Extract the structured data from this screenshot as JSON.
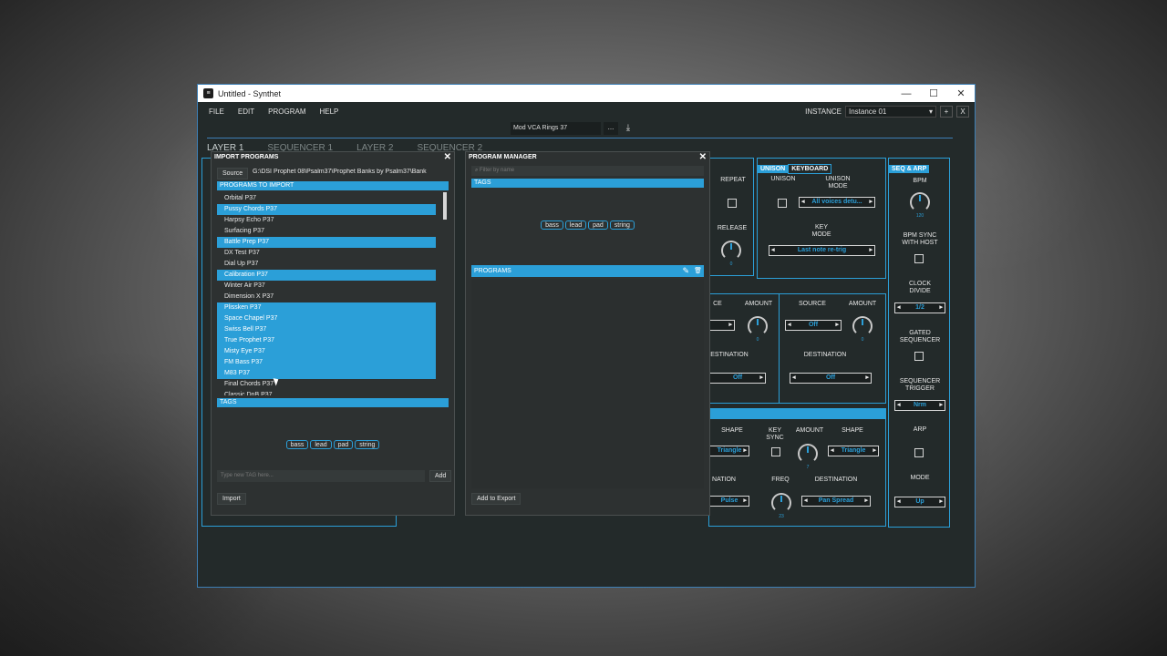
{
  "window": {
    "title": "Untitled - Synthet",
    "app_icon": "synthet-logo",
    "minimize": "—",
    "maximize": "☐",
    "close": "✕"
  },
  "menu": {
    "file": "FILE",
    "edit": "EDIT",
    "program": "PROGRAM",
    "help": "HELP",
    "instance_label": "INSTANCE",
    "instance_value": "Instance 01",
    "add": "+",
    "remove": "X"
  },
  "program_bar": {
    "name": "Mod VCA Rings 37",
    "browse": "...",
    "save_icon": "⤓"
  },
  "layer_tabs": [
    "LAYER 1",
    "SEQUENCER 1",
    "LAYER 2",
    "SEQUENCER 2"
  ],
  "synth": {
    "repeat": "REPEAT",
    "release": "RELEASE",
    "release_val": "0",
    "unison_tab": "UNISON",
    "keyboard_tab": "KEYBOARD",
    "unison": "UNISON",
    "unison_mode": "UNISON\nMODE",
    "unison_mode_val": "All voices detu...",
    "key_mode": "KEY\nMODE",
    "key_mode_val": "Last note re-trig",
    "source": "SOURCE",
    "amount": "AMOUNT",
    "amount_val": "0",
    "destination": "DESTINATION",
    "src_val": "Off",
    "dest_val": "Off",
    "shape": "SHAPE",
    "key_sync": "KEY\nSYNC",
    "lfo_amount_val": "7",
    "shape_val": "Triangle",
    "freq": "FREQ",
    "freq_val": "23",
    "lfo_dest_val": "Pan Spread",
    "pulse_val": "Pulse",
    "nation": "NATION",
    "ce": "CE",
    "estination": "ESTINATION"
  },
  "seq_arp": {
    "header": "SEQ & ARP",
    "bpm": "BPM",
    "bpm_val": "120",
    "bpm_sync": "BPM SYNC\nWITH HOST",
    "clock_divide": "CLOCK\nDIVIDE",
    "clock_val": "1/2",
    "gated": "GATED\nSEQUENCER",
    "trigger": "SEQUENCER\nTRIGGER",
    "trigger_val": "Nrm",
    "arp": "ARP",
    "mode": "MODE",
    "mode_val": "Up"
  },
  "import_dialog": {
    "title": "IMPORT PROGRAMS",
    "close": "✕",
    "source_btn": "Source",
    "source_path": "G:\\DSI Prophet 08\\Psalm37\\Prophet Banks by Psalm37\\Bank",
    "programs_header": "PROGRAMS TO IMPORT",
    "programs": [
      {
        "name": "Orbital P37",
        "selected": false
      },
      {
        "name": "Pussy Chords P37",
        "selected": true
      },
      {
        "name": "Harpsy Echo P37",
        "selected": false
      },
      {
        "name": "Surfacing  P37",
        "selected": false
      },
      {
        "name": "Battle Prep P37",
        "selected": true
      },
      {
        "name": "DX Test  P37",
        "selected": false
      },
      {
        "name": "Dial Up P37",
        "selected": false
      },
      {
        "name": "Calibration P37",
        "selected": true
      },
      {
        "name": "Winter Air P37",
        "selected": false
      },
      {
        "name": "Dimension X P37",
        "selected": false
      },
      {
        "name": "Plissken P37",
        "selected": true
      },
      {
        "name": "Space Chapel P37",
        "selected": true
      },
      {
        "name": "Swiss Bell P37",
        "selected": true
      },
      {
        "name": "True Prophet P37",
        "selected": true
      },
      {
        "name": "Misty Eye  P37",
        "selected": true
      },
      {
        "name": "FM Bass P37",
        "selected": true
      },
      {
        "name": "M83  P37",
        "selected": true
      },
      {
        "name": "Final Chords P37",
        "selected": false
      },
      {
        "name": "Classic DnB P37",
        "selected": false
      }
    ],
    "tags_header": "TAGS",
    "tags": [
      "bass",
      "lead",
      "pad",
      "string"
    ],
    "tag_placeholder": "Type new TAG here...",
    "add_btn": "Add",
    "import_btn": "Import"
  },
  "manager_dialog": {
    "title": "PROGRAM MANAGER",
    "close": "✕",
    "filter_placeholder": "Filter by name",
    "tags_header": "TAGS",
    "tags": [
      "bass",
      "lead",
      "pad",
      "string"
    ],
    "programs_header": "PROGRAMS",
    "edit_icon": "✎",
    "delete_icon": "🗑",
    "add_export_btn": "Add to Export"
  },
  "colors": {
    "accent": "#2b9fd8",
    "panel_bg": "#232a2a",
    "dialog_bg": "#2d3131"
  }
}
